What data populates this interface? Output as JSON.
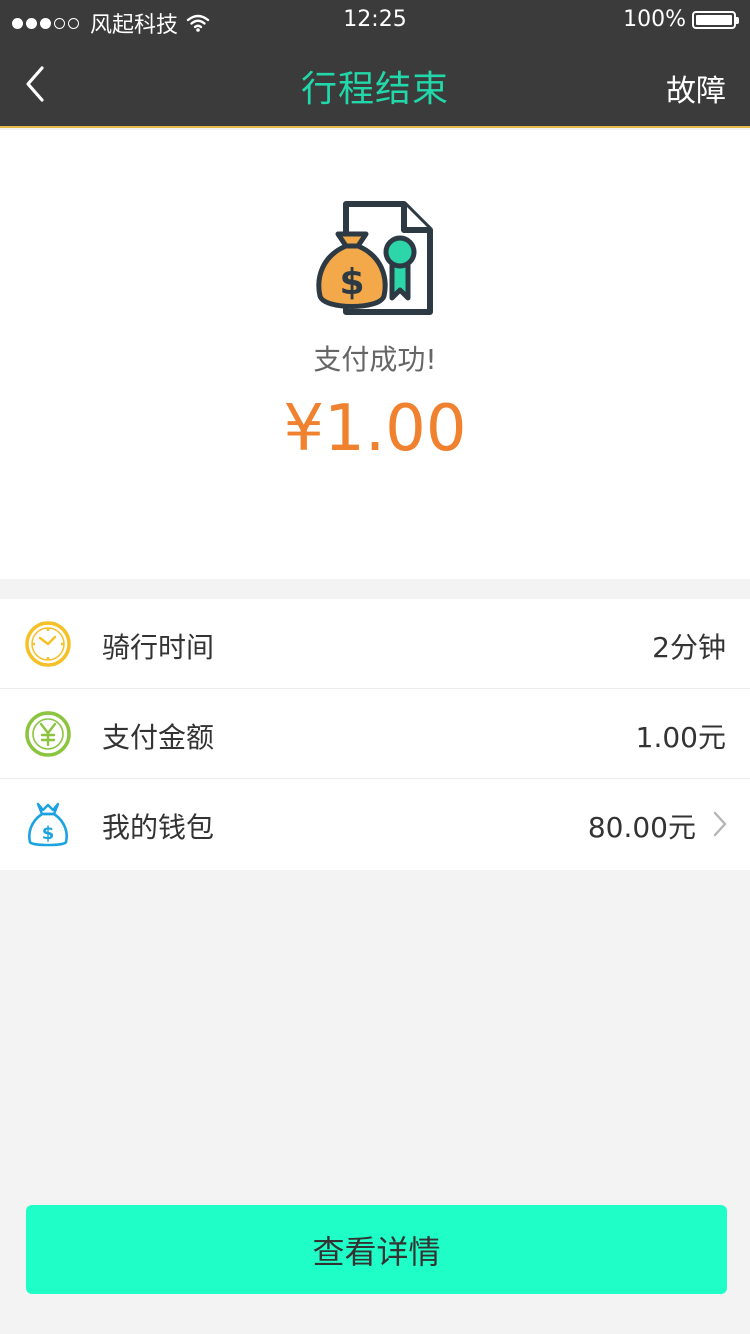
{
  "status_bar": {
    "signal_dots": [
      true,
      true,
      true,
      false,
      false
    ],
    "carrier": "风起科技",
    "wifi_icon": "wifi-icon",
    "time": "12:25",
    "battery_percent": "100%"
  },
  "nav": {
    "back_icon": "chevron-left-icon",
    "title": "行程结束",
    "right_label": "故障",
    "title_color": "#22d7a9"
  },
  "hero": {
    "icon": "money-bag-certificate-icon",
    "message": "支付成功!",
    "amount": "¥1.00",
    "amount_color": "#f0812e"
  },
  "details": [
    {
      "icon": "clock-icon",
      "label": "骑行时间",
      "value": "2分钟"
    },
    {
      "icon": "yuan-coin-icon",
      "label": "支付金额",
      "value": "1.00元"
    },
    {
      "icon": "wallet-bag-icon",
      "label": "我的钱包",
      "value": "80.00元",
      "chevron": "chevron-right-icon"
    }
  ],
  "cta": {
    "label": "查看详情",
    "color": "#1efec6"
  }
}
